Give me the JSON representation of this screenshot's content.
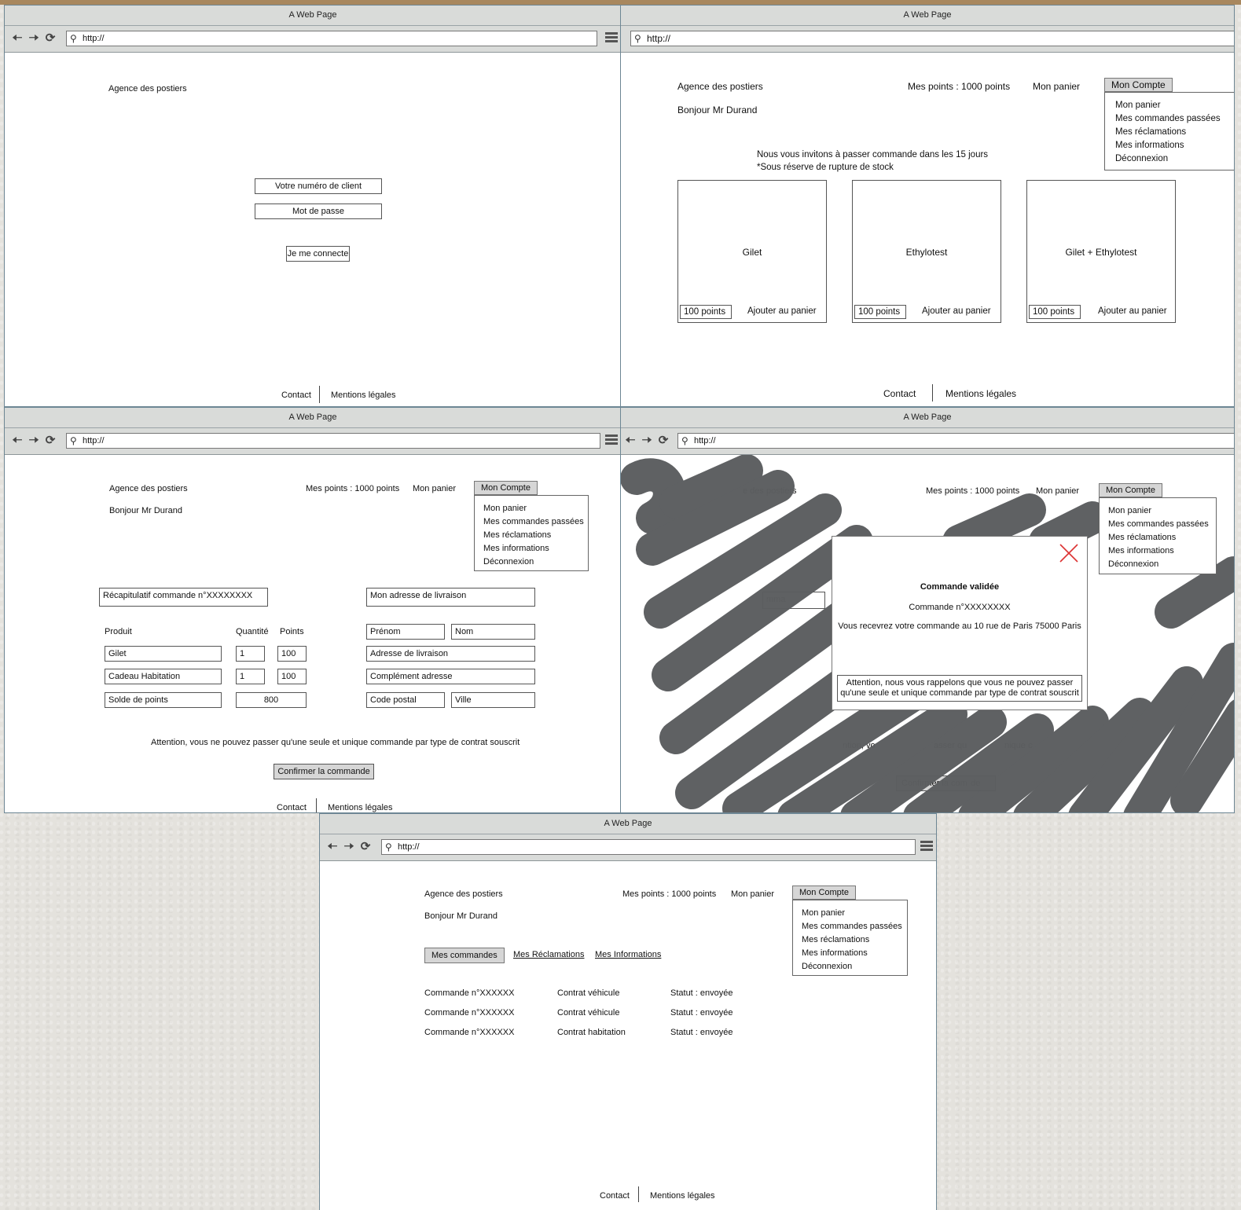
{
  "window_title": "A Web Page",
  "url": "http://",
  "brand": "Agence des postiers",
  "greeting": "Bonjour Mr Durand",
  "points": "Mes points : 1000 points",
  "cart": "Mon panier",
  "account_button": "Mon Compte",
  "account_menu": [
    "Mon panier",
    "Mes commandes passées",
    "Mes réclamations",
    "Mes informations",
    "Déconnexion"
  ],
  "footer": {
    "contact": "Contact",
    "legal": "Mentions légales"
  },
  "login": {
    "client_number": "Votre numéro de client",
    "password": "Mot de passe",
    "submit": "Je me connecte"
  },
  "catalog": {
    "invite": "Nous vous invitons à passer commande dans les 15 jours",
    "note": "*Sous réserve de rupture de stock",
    "products": [
      {
        "name": "Gilet",
        "points": "100 points",
        "add": "Ajouter au panier"
      },
      {
        "name": "Ethylotest",
        "points": "100 points",
        "add": "Ajouter au panier"
      },
      {
        "name": "Gilet + Ethylotest",
        "points": "100 points",
        "add": "Ajouter au panier"
      }
    ]
  },
  "order": {
    "summary": "Récapitulatif commande n°XXXXXXXX",
    "delivery": "Mon adresse de livraison",
    "col_product": "Produit",
    "col_qty": "Quantité",
    "col_points": "Points",
    "rows": [
      {
        "product": "Gilet",
        "qty": "1",
        "points": "100"
      },
      {
        "product": "Cadeau Habitation",
        "qty": "1",
        "points": "100"
      }
    ],
    "balance_label": "Solde de points",
    "balance_value": "800",
    "firstname": "Prénom",
    "lastname": "Nom",
    "address": "Adresse de livraison",
    "address2": "Complément adresse",
    "zip": "Code postal",
    "city": "Ville",
    "warning": "Attention, vous ne pouvez passer qu'une seule et unique commande par type de contrat souscrit",
    "confirm": "Confirmer la commande"
  },
  "modal": {
    "title": "Commande validée",
    "number": "Commande n°XXXXXXXX",
    "message": "Vous recevrez votre commande au 10 rue de Paris 75000 Paris",
    "warning_l1": "Attention, nous vous rappelons que vous ne pouvez passer",
    "warning_l2": "qu'une seule et unique commande par type de contrat souscrit",
    "bg_frag_brand": "e des postiers",
    "bg_frag_summary": "mma",
    "bg_frag_warning_a": "ntion, vo",
    "bg_frag_warning_b": "asser qu",
    "bg_frag_warning_c": "nique c",
    "bg_frag_confirm_a": "Confirmer la com",
    "bg_frag_confirm_b": "de"
  },
  "history": {
    "tabs": [
      "Mes commandes",
      "Mes Réclamations",
      "Mes Informations"
    ],
    "orders": [
      {
        "number": "Commande n°XXXXXX",
        "contract": "Contrat véhicule",
        "status": "Statut : envoyée"
      },
      {
        "number": "Commande n°XXXXXX",
        "contract": "Contrat véhicule",
        "status": "Statut : envoyée"
      },
      {
        "number": "Commande n°XXXXXX",
        "contract": "Contrat habitation",
        "status": "Statut : envoyée"
      }
    ]
  }
}
